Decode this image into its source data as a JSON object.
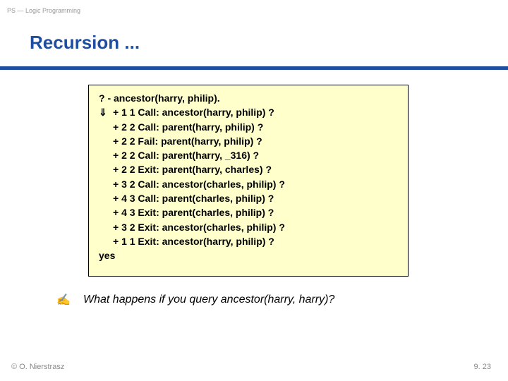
{
  "header": {
    "course_label": "PS — Logic Programming"
  },
  "title": "Recursion ...",
  "code": {
    "query": "? - ancestor(harry, philip).",
    "arrow_glyph": "⇓",
    "trace": [
      "+ 1 1 Call: ancestor(harry, philip) ?",
      "+ 2 2 Call: parent(harry, philip) ?",
      "+ 2 2 Fail: parent(harry, philip) ?",
      "+ 2 2 Call: parent(harry, _316) ?",
      "+ 2 2 Exit: parent(harry, charles) ?",
      "+ 3 2 Call: ancestor(charles, philip) ?",
      "+ 4 3 Call: parent(charles, philip) ?",
      "+ 4 3 Exit: parent(charles, philip) ?",
      "+ 3 2 Exit: ancestor(charles, philip) ?",
      "+ 1 1 Exit: ancestor(harry, philip) ?"
    ],
    "result": "yes"
  },
  "question": {
    "hand_glyph": "✍",
    "text": "What happens if you query ancestor(harry, harry)?"
  },
  "footer": {
    "copyright": "© O. Nierstrasz",
    "page": "9. 23"
  }
}
